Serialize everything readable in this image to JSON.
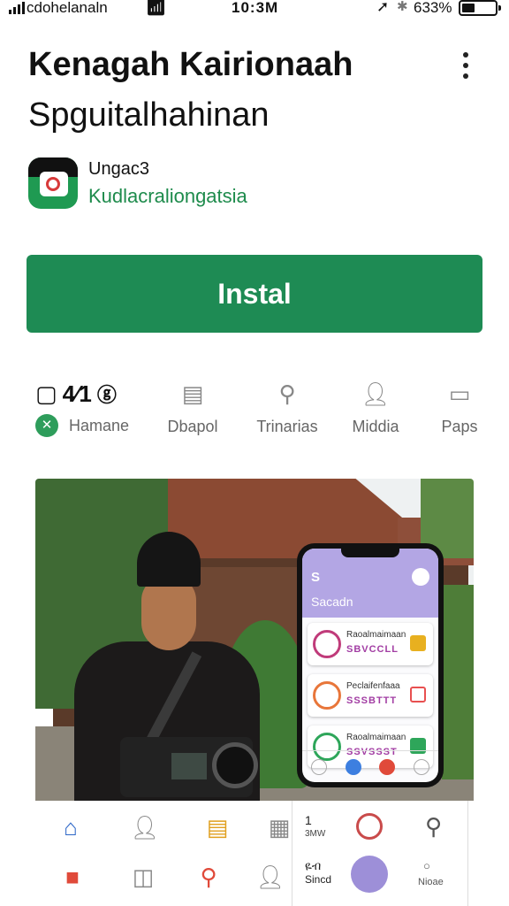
{
  "status_bar": {
    "carrier": "cdohelanaln",
    "time": "10:3M",
    "battery": "633%"
  },
  "header": {
    "title_line1": "Kenagah Kairionaah",
    "title_line2": "Spguitalhahinan"
  },
  "app": {
    "name": "Ungac3",
    "developer": "Kudlacraliongatsia"
  },
  "install_button": {
    "label": "Instal"
  },
  "tabs": [
    {
      "label": "Hamane",
      "icon": "home-icon",
      "top_text": "4⁄1"
    },
    {
      "label": "Dbapol",
      "icon": "document-icon"
    },
    {
      "label": "Trinarias",
      "icon": "search-icon"
    },
    {
      "label": "Middia",
      "icon": "person-icon"
    },
    {
      "label": "Paps",
      "icon": "chat-icon"
    }
  ],
  "screenshot": {
    "phone": {
      "logo": "S",
      "header_text": "Sacadn",
      "cards": [
        {
          "title": "Raoalmaimaan",
          "subtitle": "SBVCCLL",
          "accent": "#c03b7a",
          "badge": "#e8b020"
        },
        {
          "title": "Peclaifenfaaa",
          "subtitle": "SSSBTTT",
          "accent": "#e8763a",
          "badge": "#e85050"
        },
        {
          "title": "Raoalmaimaan",
          "subtitle": "SSVSSST",
          "accent": "#2ea65a",
          "badge": "#2ea65a"
        }
      ]
    },
    "panel": {
      "count": "1",
      "count_sub": "3MW",
      "glyph": "ዬብ",
      "label": "Sincd",
      "label2": "Nioae"
    }
  },
  "colors": {
    "accent_green": "#1e8b54",
    "developer_green": "#1e8b4c",
    "phone_header": "#b3a6e4"
  }
}
